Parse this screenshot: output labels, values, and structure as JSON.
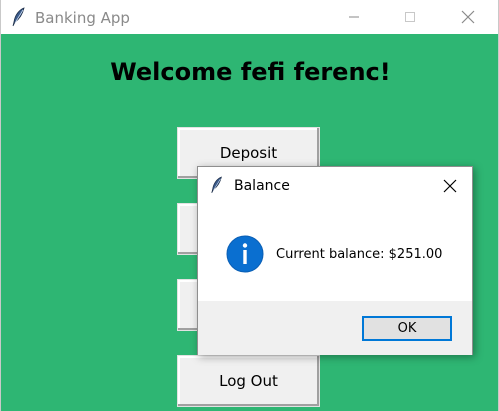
{
  "window": {
    "title": "Banking App",
    "background_color": "#2eb673"
  },
  "main": {
    "welcome_text": "Welcome fefi ferenc!",
    "buttons": [
      {
        "label": "Deposit"
      },
      {
        "label": ""
      },
      {
        "label": ""
      },
      {
        "label": "Log Out"
      }
    ]
  },
  "dialog": {
    "title": "Balance",
    "icon": "info-icon",
    "message": "Current balance: $251.00",
    "ok_label": "OK",
    "accent_color": "#0078d7"
  }
}
